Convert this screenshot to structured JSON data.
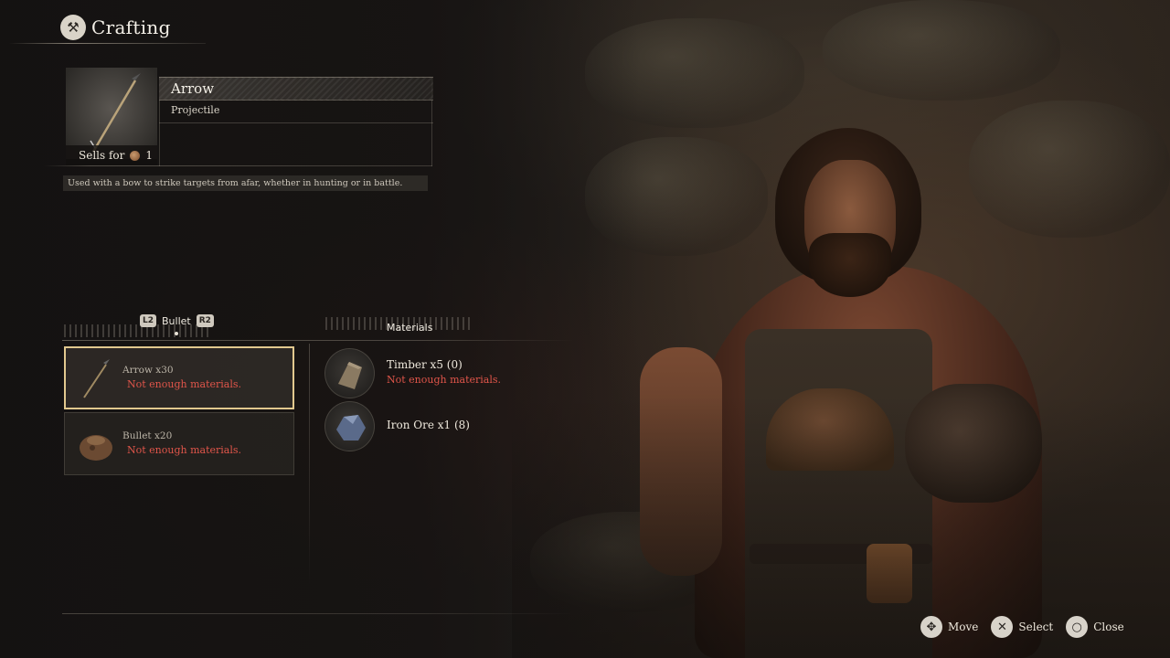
{
  "header": {
    "title": "Crafting",
    "icon": "anvil-icon"
  },
  "item": {
    "name": "Arrow",
    "type": "Projectile",
    "sells_label": "Sells for",
    "price": "1",
    "description": "Used with a bow to strike targets from afar, whether in hunting or in battle."
  },
  "tabs": {
    "left_button": "L2",
    "label": "Bullet",
    "right_button": "R2"
  },
  "materials_heading": "Materials",
  "recipes": [
    {
      "name": "Arrow x30",
      "status": "Not enough materials.",
      "icon": "arrow-icon",
      "selected": true
    },
    {
      "name": "Bullet x20",
      "status": "Not enough materials.",
      "icon": "bullet-pouch-icon",
      "selected": false
    }
  ],
  "materials": [
    {
      "name": "Timber x5 (0)",
      "status": "Not enough materials.",
      "icon": "timber-icon"
    },
    {
      "name": "Iron Ore x1 (8)",
      "status": "",
      "icon": "iron-ore-icon"
    }
  ],
  "hints": [
    {
      "button": "✥",
      "label": "Move",
      "icon": "dpad-icon"
    },
    {
      "button": "✕",
      "label": "Select",
      "icon": "cross-button-icon"
    },
    {
      "button": "○",
      "label": "Close",
      "icon": "circle-button-icon"
    }
  ],
  "colors": {
    "accent_border": "#e1c88e",
    "warning_text": "#e0554a",
    "text_primary": "#eee8dc"
  }
}
